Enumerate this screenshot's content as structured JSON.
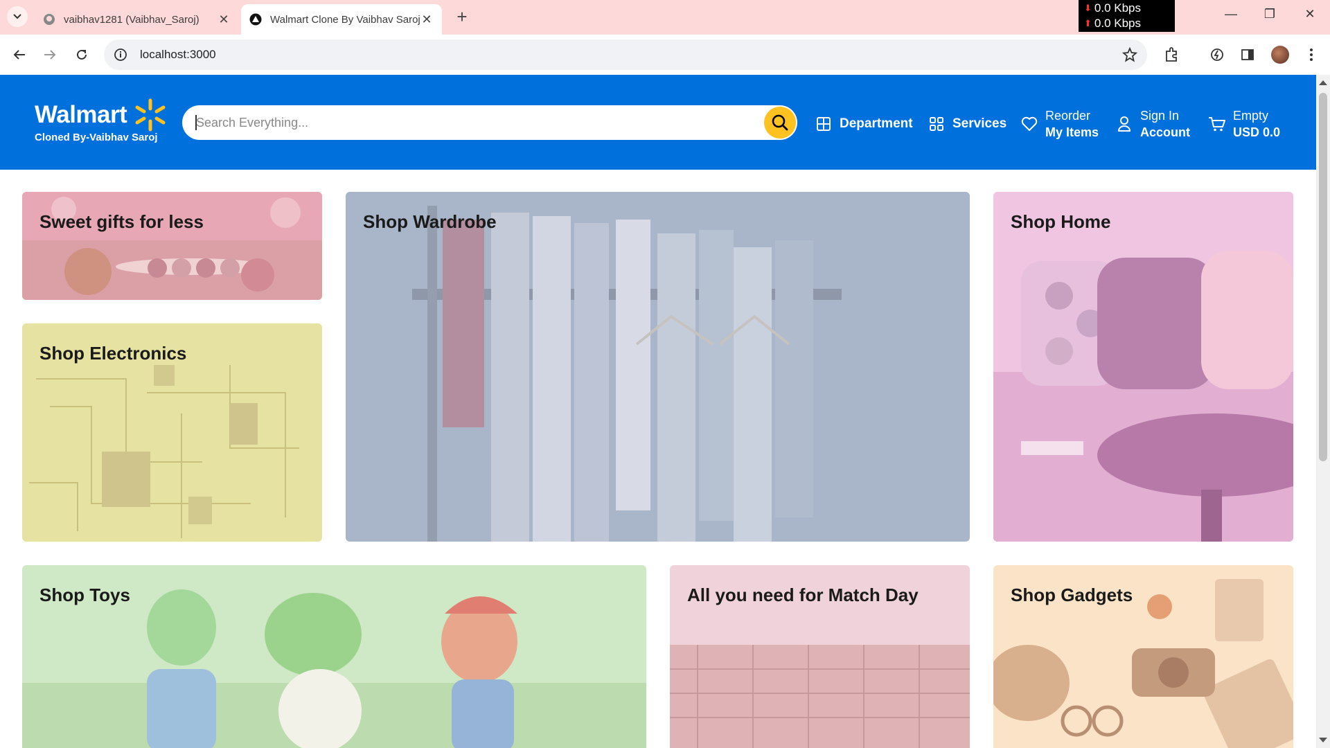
{
  "browser": {
    "tabs": [
      {
        "title": "vaibhav1281 (Vaibhav_Saroj)",
        "active": false
      },
      {
        "title": "Walmart Clone By Vaibhav Saroj",
        "active": true
      }
    ],
    "url": "localhost:3000",
    "netspeed": [
      "0.0 Kbps",
      "0.0 Kbps"
    ]
  },
  "header": {
    "brand": "Walmart",
    "subtitle": "Cloned By-Vaibhav Saroj",
    "search_placeholder": "Search Everything...",
    "nav": {
      "department": "Department",
      "services": "Services",
      "reorder_top": "Reorder",
      "reorder_bottom": "My Items",
      "signin_top": "Sign In",
      "signin_bottom": "Account",
      "cart_top": "Empty",
      "cart_bottom": "USD 0.0"
    }
  },
  "cards": {
    "sweet": "Sweet gifts for less",
    "wardrobe": "Shop Wardrobe",
    "home": "Shop Home",
    "electronics": "Shop Electronics",
    "toys": "Shop Toys",
    "match": "All you need for Match Day",
    "gadgets": "Shop Gadgets"
  },
  "colors": {
    "brand_blue": "#0071dc",
    "spark_yellow": "#ffc220"
  }
}
